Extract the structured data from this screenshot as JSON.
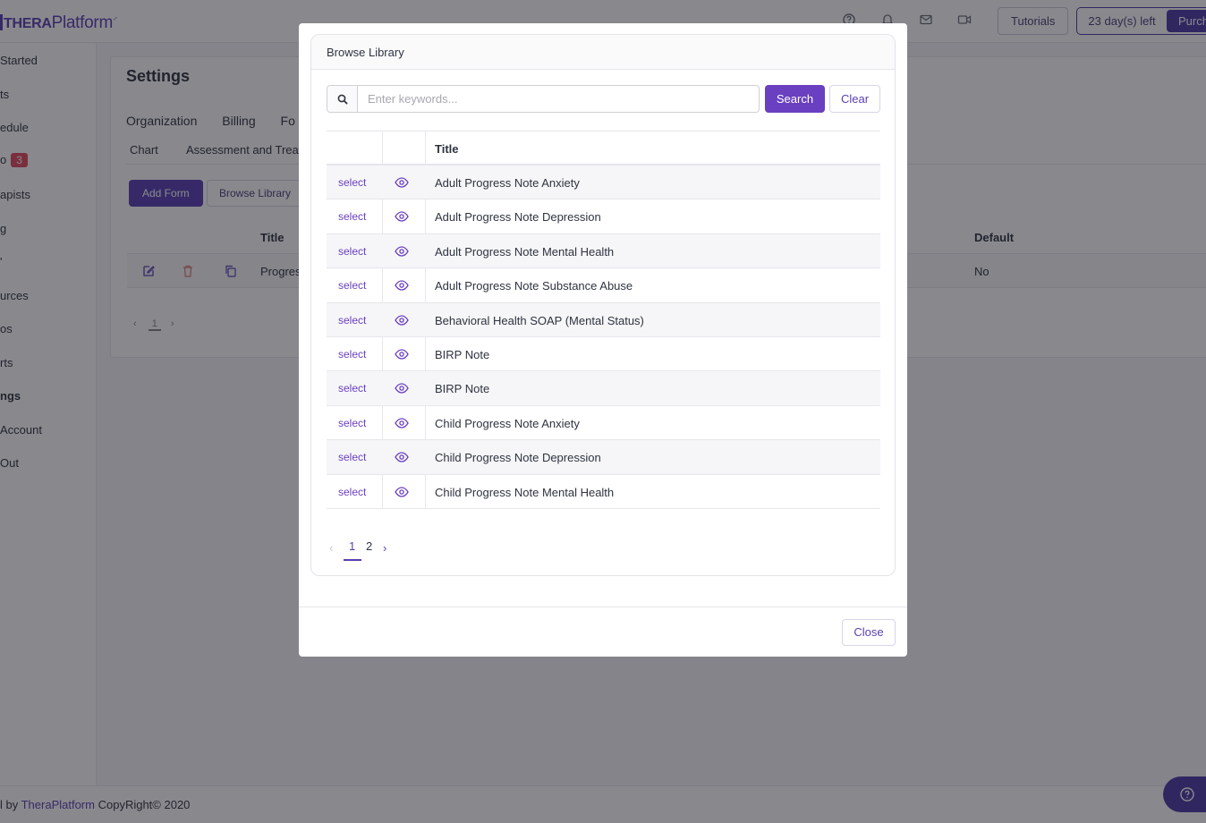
{
  "app": {
    "logo_bold": "THERA",
    "logo_rest": "Platform"
  },
  "topbar": {
    "icons": [
      "help-circle-icon",
      "bell-icon",
      "mail-icon",
      "video-icon"
    ],
    "tutorials_label": "Tutorials",
    "trial_days": "23 day(s) left",
    "purchase_label": "Purch"
  },
  "sidebar": {
    "items": [
      {
        "label": "Started"
      },
      {
        "label": "ts"
      },
      {
        "label": "edule"
      },
      {
        "label": "o",
        "badge": "3"
      },
      {
        "label": "apists"
      },
      {
        "label": "g"
      },
      {
        "label": "'"
      },
      {
        "label": "urces"
      },
      {
        "label": "os"
      },
      {
        "label": "rts"
      },
      {
        "label": "ngs",
        "active": true
      },
      {
        "label": "Account"
      },
      {
        "label": "Out"
      }
    ]
  },
  "settings": {
    "title": "Settings",
    "tabs": [
      "Organization",
      "Billing",
      "Fo"
    ],
    "subtabs": [
      "Chart",
      "Assessment and Treat"
    ],
    "add_form_label": "Add Form",
    "browse_library_label": "Browse Library",
    "table": {
      "title_header": "Title",
      "default_header": "Default",
      "row_title": "Progres",
      "row_default": "No"
    },
    "pager_current": "1"
  },
  "footer": {
    "prefix": "l by ",
    "brand": "TheraPlatform",
    "suffix": " CopyRight© 2020"
  },
  "help_icon": "help-circle-icon",
  "modal": {
    "header_title": "Browse Library",
    "search": {
      "placeholder": "Enter keywords...",
      "value": "",
      "button_label": "Search",
      "clear_label": "Clear"
    },
    "table": {
      "title_header": "Title",
      "select_label": "select",
      "rows": [
        "Adult Progress Note Anxiety",
        "Adult Progress Note Depression",
        "Adult Progress Note Mental Health",
        "Adult Progress Note Substance Abuse",
        "Behavioral Health SOAP (Mental Status)",
        "BIRP Note",
        "BIRP Note",
        "Child Progress Note Anxiety",
        "Child Progress Note Depression",
        "Child Progress Note Mental Health"
      ]
    },
    "pagination": {
      "pages": [
        "1",
        "2"
      ],
      "current": "1"
    },
    "close_label": "Close"
  },
  "colors": {
    "accent": "#6a3fc0",
    "brand": "#5b3fb5",
    "badge": "#e04a5f"
  }
}
